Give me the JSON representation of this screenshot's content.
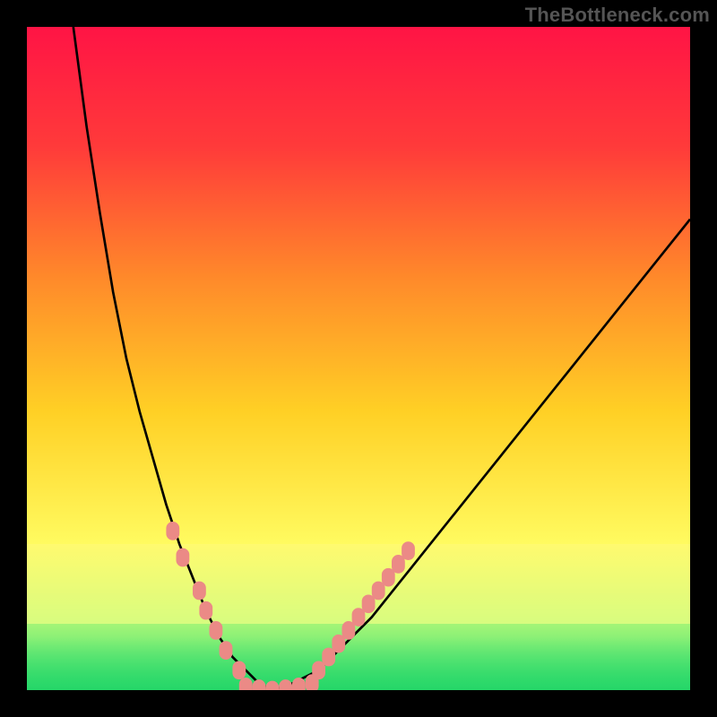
{
  "watermark": "TheBottleneck.com",
  "chart_data": {
    "type": "line",
    "title": "",
    "xlabel": "",
    "ylabel": "",
    "xlim": [
      0,
      100
    ],
    "ylim": [
      0,
      100
    ],
    "grid": false,
    "legend": false,
    "background_gradient_stops": [
      {
        "offset": 0.0,
        "color": "#ff1445"
      },
      {
        "offset": 0.18,
        "color": "#ff3a3a"
      },
      {
        "offset": 0.38,
        "color": "#ff8a2a"
      },
      {
        "offset": 0.58,
        "color": "#ffd025"
      },
      {
        "offset": 0.78,
        "color": "#fffb60"
      },
      {
        "offset": 0.92,
        "color": "#c0ff7a"
      },
      {
        "offset": 1.0,
        "color": "#2fe879"
      }
    ],
    "highlight_bands": [
      {
        "name": "low-bottleneck",
        "y_from": 78,
        "y_to": 90,
        "color": "pale-yellow"
      },
      {
        "name": "ideal",
        "y_from": 90,
        "y_to": 100,
        "color": "green"
      }
    ],
    "series": [
      {
        "name": "bottleneck-curve-left",
        "color": "#000000",
        "stroke_width": 2,
        "x": [
          7,
          9,
          11,
          13,
          15,
          17,
          19,
          21,
          23,
          25,
          27,
          29,
          31,
          33,
          35,
          37
        ],
        "y": [
          0,
          15,
          28,
          40,
          50,
          58,
          65,
          72,
          78,
          83,
          88,
          92,
          95,
          97,
          99,
          100
        ]
      },
      {
        "name": "bottleneck-curve-right",
        "color": "#000000",
        "stroke_width": 2,
        "x": [
          37,
          40,
          44,
          48,
          52,
          56,
          60,
          64,
          68,
          72,
          76,
          80,
          84,
          88,
          92,
          96,
          100
        ],
        "y": [
          100,
          99,
          97,
          93,
          89,
          84,
          79,
          74,
          69,
          64,
          59,
          54,
          49,
          44,
          39,
          34,
          29
        ]
      },
      {
        "name": "marker-cluster-left",
        "type": "scatter",
        "color": "#eb8a86",
        "marker": "rounded-rect",
        "x": [
          22,
          23.5,
          26,
          27,
          28.5,
          30,
          32
        ],
        "y": [
          76,
          80,
          85,
          88,
          91,
          94,
          97
        ]
      },
      {
        "name": "marker-cluster-bottom",
        "type": "scatter",
        "color": "#eb8a86",
        "marker": "rounded-rect",
        "x": [
          33,
          35,
          37,
          39,
          41,
          43
        ],
        "y": [
          99.5,
          99.8,
          100,
          99.8,
          99.5,
          99
        ]
      },
      {
        "name": "marker-cluster-right",
        "type": "scatter",
        "color": "#eb8a86",
        "marker": "rounded-rect",
        "x": [
          44,
          45.5,
          47,
          48.5,
          50,
          51.5,
          53,
          54.5,
          56,
          57.5
        ],
        "y": [
          97,
          95,
          93,
          91,
          89,
          87,
          85,
          83,
          81,
          79
        ]
      }
    ],
    "annotations": []
  }
}
